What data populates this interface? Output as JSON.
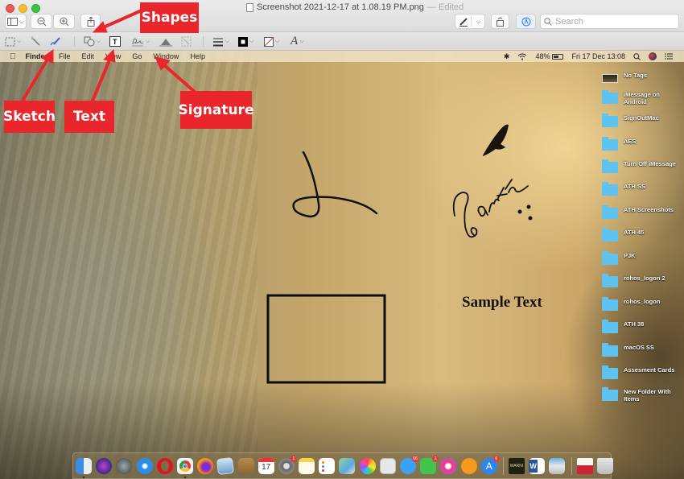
{
  "window": {
    "title": "Screenshot 2021-12-17 at 1.08.19 PM.png",
    "title_suffix": "— Edited",
    "search_placeholder": "Search",
    "toolbar": {
      "sidebar_toggle": "sidebar-icon",
      "zoom_out": "zoom-out-icon",
      "zoom_in": "zoom-in-icon",
      "share": "share-icon",
      "markup_pen": "pen-icon",
      "rotate": "rotate-icon",
      "markup_toggle": "markup-icon"
    },
    "markup_tools": [
      {
        "id": "rect-select",
        "icon": "rectangular-selection-icon",
        "has_menu": true
      },
      {
        "id": "instant-alpha",
        "icon": "magic-wand-icon",
        "has_menu": false
      },
      {
        "id": "sketch",
        "icon": "sketch-icon",
        "has_menu": false
      },
      {
        "id": "shapes",
        "icon": "shapes-icon",
        "has_menu": true
      },
      {
        "id": "text",
        "icon": "text-box-icon",
        "has_menu": false
      },
      {
        "id": "sign",
        "icon": "signature-icon",
        "has_menu": true
      },
      {
        "id": "adjust-color",
        "icon": "adjust-color-icon",
        "has_menu": false
      },
      {
        "id": "adjust-size",
        "icon": "resize-icon",
        "has_menu": false
      },
      {
        "id": "shape-style",
        "icon": "line-style-icon",
        "has_menu": true
      },
      {
        "id": "border-color",
        "icon": "border-color-icon",
        "has_menu": true
      },
      {
        "id": "fill-color",
        "icon": "fill-color-icon",
        "has_menu": true
      },
      {
        "id": "text-style",
        "icon": "text-style-icon",
        "has_menu": true
      }
    ]
  },
  "menubar": {
    "app": "Finder",
    "items": [
      "File",
      "Edit",
      "View",
      "Go",
      "Window",
      "Help"
    ],
    "battery": "48%",
    "datetime": "Fri 17 Dec  13:08"
  },
  "desktop_items": [
    {
      "label": "No Tags",
      "type": "image"
    },
    {
      "label": "iMessage on Android",
      "type": "folder"
    },
    {
      "label": "SignOutMac",
      "type": "folder"
    },
    {
      "label": "AES",
      "type": "folder"
    },
    {
      "label": "Turn Off iMessage",
      "type": "folder"
    },
    {
      "label": "ATH SS",
      "type": "folder"
    },
    {
      "label": "ATH Screenshots",
      "type": "folder"
    },
    {
      "label": "ATH 45",
      "type": "folder"
    },
    {
      "label": "PJK",
      "type": "folder"
    },
    {
      "label": "rohos_logon 2",
      "type": "folder"
    },
    {
      "label": "rohos_logon",
      "type": "folder"
    },
    {
      "label": "ATH 38",
      "type": "folder"
    },
    {
      "label": "macOS SS",
      "type": "folder"
    },
    {
      "label": "Assesment Cards",
      "type": "folder"
    },
    {
      "label": "New Folder With Items",
      "type": "folder"
    }
  ],
  "annotations": {
    "sample_text": "Sample Text",
    "signature": "Earth"
  },
  "callouts": {
    "shapes": "Shapes",
    "sketch": "Sketch",
    "text": "Text",
    "signature": "Signature"
  },
  "callout_color": "#e8262b",
  "dock": {
    "apps": [
      {
        "name": "Finder",
        "badge": ""
      },
      {
        "name": "Siri",
        "badge": ""
      },
      {
        "name": "Launchpad",
        "badge": ""
      },
      {
        "name": "Safari",
        "badge": ""
      },
      {
        "name": "Opera",
        "badge": ""
      },
      {
        "name": "Chrome",
        "badge": ""
      },
      {
        "name": "Firefox",
        "badge": ""
      },
      {
        "name": "Preview",
        "badge": ""
      },
      {
        "name": "Notebook",
        "badge": ""
      },
      {
        "name": "Calendar",
        "badge": "",
        "text": "17"
      },
      {
        "name": "System Preferences",
        "badge": "1"
      },
      {
        "name": "Notes",
        "badge": ""
      },
      {
        "name": "Reminders",
        "badge": ""
      },
      {
        "name": "Maps",
        "badge": ""
      },
      {
        "name": "Photos",
        "badge": ""
      },
      {
        "name": "Screenshot",
        "badge": ""
      },
      {
        "name": "Messages",
        "badge": "66"
      },
      {
        "name": "FaceTime",
        "badge": "1"
      },
      {
        "name": "Music",
        "badge": ""
      },
      {
        "name": "Books",
        "badge": ""
      },
      {
        "name": "App Store",
        "badge": "6"
      },
      {
        "name": "Console",
        "badge": "",
        "text": "WARNI"
      },
      {
        "name": "Word",
        "badge": "",
        "text": "W"
      },
      {
        "name": "Image Capture",
        "badge": ""
      },
      {
        "name": "Documents Stack",
        "badge": ""
      },
      {
        "name": "Trash",
        "badge": ""
      }
    ]
  }
}
